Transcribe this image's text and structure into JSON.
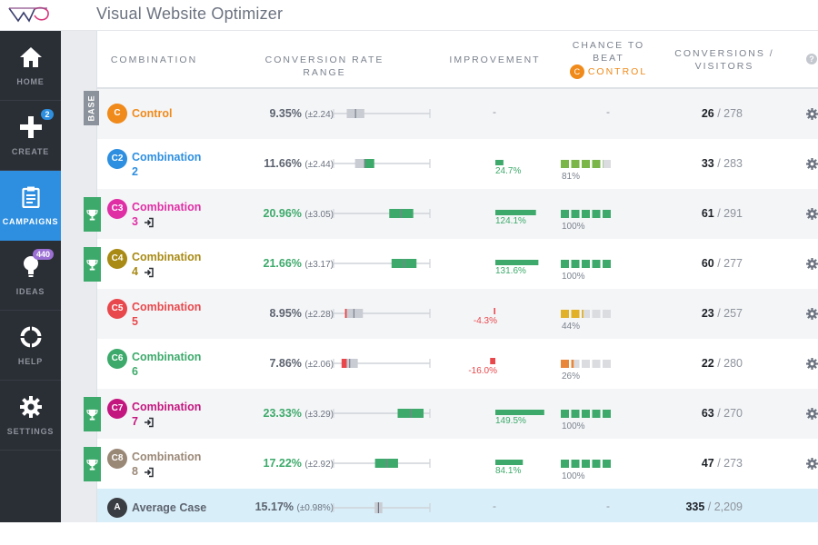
{
  "app": {
    "title": "Visual Website Optimizer",
    "logo": "vwo-logo"
  },
  "sidebar": {
    "items": [
      {
        "id": "home",
        "label": "HOME",
        "icon": "home-icon",
        "active": false
      },
      {
        "id": "create",
        "label": "CREATE",
        "icon": "plus-icon",
        "active": false,
        "badge": "2"
      },
      {
        "id": "campaigns",
        "label": "CAMPAIGNS",
        "icon": "clipboard-icon",
        "active": true
      },
      {
        "id": "ideas",
        "label": "IDEAS",
        "icon": "lightbulb-icon",
        "active": false,
        "badge": "440"
      },
      {
        "id": "help",
        "label": "HELP",
        "icon": "lifebuoy-icon",
        "active": false
      },
      {
        "id": "settings",
        "label": "SETTINGS",
        "icon": "gear-icon",
        "active": false
      }
    ]
  },
  "table": {
    "headers": {
      "combination": "COMBINATION",
      "rate_range": "CONVERSION RATE RANGE",
      "improvement": "IMPROVEMENT",
      "chance_line1": "CHANCE TO",
      "chance_line2": "BEAT",
      "chance_badge": "C",
      "chance_control": "CONTROL",
      "conversions_line1": "CONVERSIONS /",
      "conversions_line2": "VISITORS",
      "help": "?"
    },
    "base_label": "BASE",
    "colors": {
      "green": "#3daa6b",
      "lightgreen": "#7ab648",
      "gray": "#c9ccd3",
      "red": "#e8484c",
      "yellow": "#e2b12a",
      "orange": "#e8873a"
    },
    "rows": [
      {
        "badge": "C",
        "name": "Control",
        "name2": "",
        "color": "#f08a1a",
        "rate": "9.35%",
        "margin": "(±2.24)",
        "rate_good": false,
        "low": 7.11,
        "mid": 9.35,
        "high": 11.59,
        "improvement": null,
        "chance": null,
        "conversions": "26",
        "visitors": "278",
        "winner": false,
        "base": true,
        "goto": false
      },
      {
        "badge": "C2",
        "name": "Combination",
        "name2": "2",
        "color": "#2e8fe0",
        "rate": "11.66%",
        "margin": "(±2.44)",
        "rate_good": false,
        "low": 9.22,
        "mid": 11.66,
        "high": 14.1,
        "improvement": 24.7,
        "improvement_label": "24.7%",
        "chance": 81,
        "chance_label": "81%",
        "chance_color": "lightgreen",
        "conversions": "33",
        "visitors": "283",
        "winner": false,
        "base": false,
        "goto": false
      },
      {
        "badge": "C3",
        "name": "Combination",
        "name2": "3",
        "color": "#e02fa5",
        "rate": "20.96%",
        "margin": "(±3.05)",
        "rate_good": true,
        "low": 17.91,
        "mid": 20.96,
        "high": 24.01,
        "improvement": 124.1,
        "improvement_label": "124.1%",
        "chance": 100,
        "chance_label": "100%",
        "chance_color": "green",
        "conversions": "61",
        "visitors": "291",
        "winner": true,
        "base": false,
        "goto": true
      },
      {
        "badge": "C4",
        "name": "Combination",
        "name2": "4",
        "color": "#a88a14",
        "rate": "21.66%",
        "margin": "(±3.17)",
        "rate_good": true,
        "low": 18.49,
        "mid": 21.66,
        "high": 24.83,
        "improvement": 131.6,
        "improvement_label": "131.6%",
        "chance": 100,
        "chance_label": "100%",
        "chance_color": "green",
        "conversions": "60",
        "visitors": "277",
        "winner": true,
        "base": false,
        "goto": true
      },
      {
        "badge": "C5",
        "name": "Combination",
        "name2": "5",
        "color": "#e8484c",
        "rate": "8.95%",
        "margin": "(±2.28)",
        "rate_good": false,
        "low": 6.67,
        "mid": 8.95,
        "high": 11.23,
        "improvement": -4.3,
        "improvement_label": "-4.3%",
        "chance": 44,
        "chance_label": "44%",
        "chance_color": "yellow",
        "conversions": "23",
        "visitors": "257",
        "winner": false,
        "base": false,
        "goto": false
      },
      {
        "badge": "C6",
        "name": "Combination",
        "name2": "6",
        "color": "#3daa6b",
        "rate": "7.86%",
        "margin": "(±2.06)",
        "rate_good": false,
        "low": 5.8,
        "mid": 7.86,
        "high": 9.92,
        "improvement": -16.0,
        "improvement_label": "-16.0%",
        "chance": 26,
        "chance_label": "26%",
        "chance_color": "orange",
        "conversions": "22",
        "visitors": "280",
        "winner": false,
        "base": false,
        "goto": false
      },
      {
        "badge": "C7",
        "name": "Combination",
        "name2": "7",
        "color": "#c4167f",
        "rate": "23.33%",
        "margin": "(±3.29)",
        "rate_good": true,
        "low": 20.04,
        "mid": 23.33,
        "high": 26.62,
        "improvement": 149.5,
        "improvement_label": "149.5%",
        "chance": 100,
        "chance_label": "100%",
        "chance_color": "green",
        "conversions": "63",
        "visitors": "270",
        "winner": true,
        "base": false,
        "goto": true
      },
      {
        "badge": "C8",
        "name": "Combination",
        "name2": "8",
        "color": "#9a8877",
        "rate": "17.22%",
        "margin": "(±2.92)",
        "rate_good": true,
        "low": 14.3,
        "mid": 17.22,
        "high": 20.14,
        "improvement": 84.1,
        "improvement_label": "84.1%",
        "chance": 100,
        "chance_label": "100%",
        "chance_color": "green",
        "conversions": "47",
        "visitors": "273",
        "winner": true,
        "base": false,
        "goto": true
      }
    ],
    "average": {
      "badge": "A",
      "name": "Average Case",
      "color": "#3a3d42",
      "rate": "15.17%",
      "margin": "(±0.98%)",
      "low": 14.19,
      "mid": 15.17,
      "high": 16.15,
      "improvement": "-",
      "chance": "-",
      "conversions": "335",
      "visitors": "2,209"
    },
    "range_axis": [
      4,
      28
    ]
  }
}
